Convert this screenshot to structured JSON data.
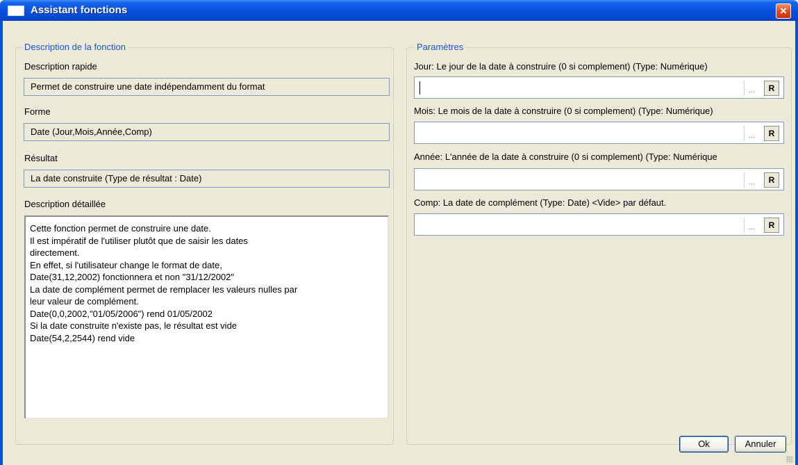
{
  "window": {
    "title": "Assistant fonctions",
    "close_label": "×"
  },
  "description_group": {
    "title": "Description de la fonction",
    "quick_label": "Description rapide",
    "quick_value": "Permet de construire une date indépendamment du format",
    "form_label": "Forme",
    "form_value": "Date (Jour,Mois,Année,Comp)",
    "result_label": "Résultat",
    "result_value": "La date construite (Type de résultat : Date)",
    "detail_label": "Description détaillée",
    "detail_text": "Cette fonction permet de construire une date.\nIl est impératif de l'utiliser plutôt que de saisir les dates\ndirectement.\nEn effet, si l'utilisateur change le format de date,\nDate(31,12,2002) fonctionnera et non \"31/12/2002\"\nLa date de complément permet de remplacer les valeurs nulles par\nleur valeur de complément.\nDate(0,0,2002,\"01/05/2006\") rend 01/05/2002\nSi la date construite n'existe pas, le résultat est vide\nDate(54,2,2544) rend vide"
  },
  "params_group": {
    "title": "Paramètres",
    "params": [
      {
        "label": "Jour: Le jour de la date à construire (0 si complement) (Type: Numérique)",
        "value": "",
        "ellipsis": "...",
        "fx": "R"
      },
      {
        "label": "Mois: Le mois de la date à construire (0 si complement) (Type: Numérique)",
        "value": "",
        "ellipsis": "...",
        "fx": "R"
      },
      {
        "label": "Année: L'année de la date à construire (0 si complement) (Type: Numérique",
        "value": "",
        "ellipsis": "...",
        "fx": "R"
      },
      {
        "label": "Comp: La date de complément (Type: Date) <Vide> par défaut.",
        "value": "",
        "ellipsis": "...",
        "fx": "R"
      }
    ]
  },
  "buttons": {
    "ok": "Ok",
    "cancel": "Annuler"
  },
  "colors": {
    "titlebar": "#0a54e0",
    "client_bg": "#ece9d8",
    "group_title": "#1a55d4",
    "close_button": "#d8471b"
  }
}
